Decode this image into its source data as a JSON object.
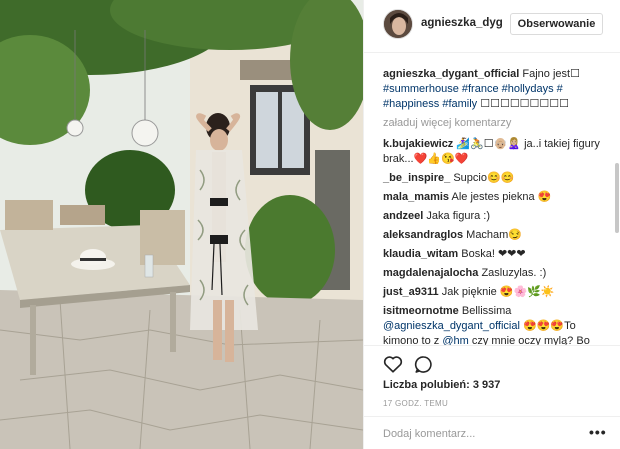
{
  "header": {
    "username": "agnieszka_dyg",
    "follow_label": "Obserwowanie"
  },
  "caption": {
    "username": "agnieszka_dygant_official",
    "text": "Fajno jest☐",
    "tags": "#summerhouse #france #hollydays # #happiness #family",
    "tail": "☐☐☐☐☐☐☐☐☐"
  },
  "load_more_label": "załaduj więcej komentarzy",
  "comments": [
    {
      "user": "k.bujakiewicz",
      "text": "🏄‍♀️🚴☐👴🏼🙎🏼‍♀️ ja..i takiej figury brak...❤️👍😘❤️"
    },
    {
      "user": "_be_inspire_",
      "text": "Supcio😊😊"
    },
    {
      "user": "mala_mamis",
      "text": "Ale jestes piekna 😍"
    },
    {
      "user": "andzeel",
      "text": "Jaka figura :)"
    },
    {
      "user": "aleksandraglos",
      "text": "Macham😏"
    },
    {
      "user": "klaudia_witam",
      "text": "Boska! ❤❤❤"
    },
    {
      "user": "magdalenajalocha",
      "text": "Zasluzylas. :)"
    },
    {
      "user": "just_a9311",
      "text": "Jak pięknie 😍🌸🌿☀️"
    },
    {
      "user": "isitmeornotme",
      "text": "Bellissima",
      "mention": "@agnieszka_dygant_official",
      "after": "😍😍😍To kimono to z",
      "mention2": "@hm",
      "after2": "czy mnie oczy mylą? Bo wygląda jak za milion monet, ale nie to"
    }
  ],
  "likes_label": "Liczba polubień: 3 937",
  "time_label": "17 GODZ. TEMU",
  "add_comment_placeholder": "Dodaj komentarz...",
  "more_label": "•••",
  "icons": {
    "heart": "heart-icon",
    "comment": "comment-icon",
    "more": "more-options-icon"
  },
  "colors": {
    "tag": "#003569",
    "muted": "#999999",
    "text": "#262626",
    "border": "#efefef"
  }
}
